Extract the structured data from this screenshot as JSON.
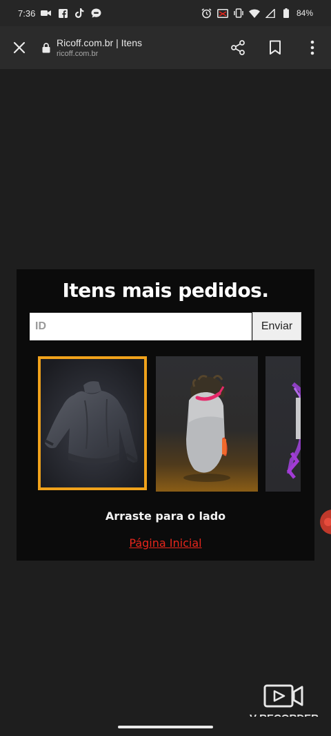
{
  "status_bar": {
    "time": "7:36",
    "left_icons": [
      "video-camera-icon",
      "facebook-icon",
      "tiktok-icon",
      "message-icon"
    ],
    "right_icons": [
      "alarm-icon",
      "cast-icon",
      "vibrate-icon",
      "wifi-icon",
      "signal-icon",
      "battery-icon"
    ],
    "battery": "84%"
  },
  "browser": {
    "title": "Ricoff.com.br | Itens",
    "domain": "ricoff.com.br"
  },
  "page": {
    "heading": "Itens mais pedidos.",
    "id_placeholder": "ID",
    "id_value": "",
    "submit_label": "Enviar",
    "items": [
      {
        "name": "turtleneck-sweater",
        "selected": true
      },
      {
        "name": "head-mask",
        "selected": false
      },
      {
        "name": "partial-item",
        "selected": false
      }
    ],
    "hint": "Arraste para o lado",
    "home_link": "Página Inicial"
  },
  "watermark": {
    "label": "V RECORDER"
  },
  "colors": {
    "accent_border": "#f0a21b",
    "link": "#e8261c",
    "card_bg": "#0b0b0b",
    "page_bg": "#1e1e1e"
  }
}
